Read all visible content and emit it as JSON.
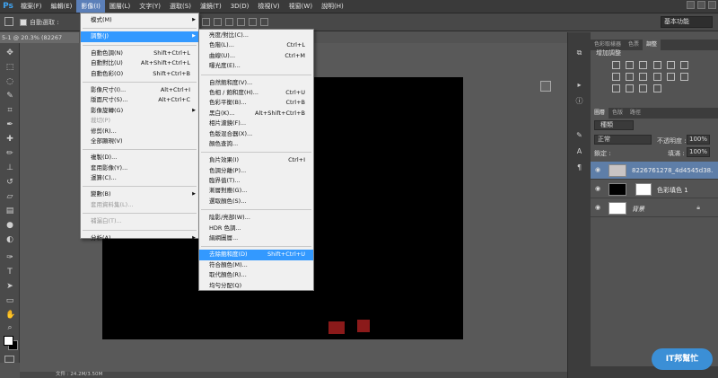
{
  "menubar": {
    "logo": "Ps",
    "items": [
      "檔案(F)",
      "編輯(E)",
      "影像(I)",
      "圖層(L)",
      "文字(Y)",
      "選取(S)",
      "濾鏡(T)",
      "3D(D)",
      "檢視(V)",
      "視窗(W)",
      "說明(H)"
    ]
  },
  "options": {
    "autoselect_label": "自動選取 :",
    "workspace": "基本功能"
  },
  "document": {
    "tab_label": "5-1 @ 20.3% (82267",
    "status_text": "文件 : 24.2M/3.50M"
  },
  "image_menu": {
    "items": [
      {
        "label": "模式(M)",
        "shortcut": "",
        "submenu": true,
        "disabled": false
      },
      {
        "sep": true
      },
      {
        "label": "調整(J)",
        "shortcut": "",
        "submenu": true,
        "disabled": false,
        "highlight": true
      },
      {
        "sep": true
      },
      {
        "label": "自動色調(N)",
        "shortcut": "Shift+Ctrl+L",
        "submenu": false,
        "disabled": false
      },
      {
        "label": "自動對比(U)",
        "shortcut": "Alt+Shift+Ctrl+L",
        "submenu": false,
        "disabled": false
      },
      {
        "label": "自動色彩(O)",
        "shortcut": "Shift+Ctrl+B",
        "submenu": false,
        "disabled": false
      },
      {
        "sep": true
      },
      {
        "label": "影像尺寸(I)...",
        "shortcut": "Alt+Ctrl+I",
        "submenu": false,
        "disabled": false
      },
      {
        "label": "版面尺寸(S)...",
        "shortcut": "Alt+Ctrl+C",
        "submenu": false,
        "disabled": false
      },
      {
        "label": "影像旋轉(G)",
        "shortcut": "",
        "submenu": true,
        "disabled": false
      },
      {
        "label": "裁切(P)",
        "shortcut": "",
        "submenu": false,
        "disabled": true
      },
      {
        "label": "修剪(R)...",
        "shortcut": "",
        "submenu": false,
        "disabled": false
      },
      {
        "label": "全部顯現(V)",
        "shortcut": "",
        "submenu": false,
        "disabled": false
      },
      {
        "sep": true
      },
      {
        "label": "複製(D)...",
        "shortcut": "",
        "submenu": false,
        "disabled": false
      },
      {
        "label": "套用影像(Y)...",
        "shortcut": "",
        "submenu": false,
        "disabled": false
      },
      {
        "label": "運算(C)...",
        "shortcut": "",
        "submenu": false,
        "disabled": false
      },
      {
        "sep": true
      },
      {
        "label": "變數(B)",
        "shortcut": "",
        "submenu": true,
        "disabled": false
      },
      {
        "label": "套用資料集(L)...",
        "shortcut": "",
        "submenu": false,
        "disabled": true
      },
      {
        "sep": true
      },
      {
        "label": "補漏白(T)...",
        "shortcut": "",
        "submenu": false,
        "disabled": true
      },
      {
        "sep": true
      },
      {
        "label": "分析(A)",
        "shortcut": "",
        "submenu": true,
        "disabled": false
      }
    ]
  },
  "adjust_menu": {
    "items": [
      {
        "label": "亮度/對比(C)...",
        "shortcut": ""
      },
      {
        "label": "色階(L)...",
        "shortcut": "Ctrl+L"
      },
      {
        "label": "曲線(U)...",
        "shortcut": "Ctrl+M"
      },
      {
        "label": "曝光度(E)...",
        "shortcut": ""
      },
      {
        "sep": true
      },
      {
        "label": "自然飽和度(V)...",
        "shortcut": ""
      },
      {
        "label": "色相 / 飽和度(H)...",
        "shortcut": "Ctrl+U"
      },
      {
        "label": "色彩平衡(B)...",
        "shortcut": "Ctrl+B"
      },
      {
        "label": "黑白(K)...",
        "shortcut": "Alt+Shift+Ctrl+B"
      },
      {
        "label": "相片濾鏡(F)...",
        "shortcut": ""
      },
      {
        "label": "色版混合器(X)...",
        "shortcut": ""
      },
      {
        "label": "顏色查詢...",
        "shortcut": ""
      },
      {
        "sep": true
      },
      {
        "label": "負片效果(I)",
        "shortcut": "Ctrl+I"
      },
      {
        "label": "色調分離(P)...",
        "shortcut": ""
      },
      {
        "label": "臨界值(T)...",
        "shortcut": ""
      },
      {
        "label": "漸層對應(G)...",
        "shortcut": ""
      },
      {
        "label": "選取顏色(S)...",
        "shortcut": ""
      },
      {
        "sep": true
      },
      {
        "label": "陰影/亮部(W)...",
        "shortcut": ""
      },
      {
        "label": "HDR 色調...",
        "shortcut": ""
      },
      {
        "label": "絹網圖層...",
        "shortcut": ""
      },
      {
        "sep": true
      },
      {
        "label": "去除飽和度(D)",
        "shortcut": "Shift+Ctrl+U",
        "highlight": true
      },
      {
        "label": "符合顏色(M)...",
        "shortcut": ""
      },
      {
        "label": "取代顏色(R)...",
        "shortcut": ""
      },
      {
        "label": "均勻分配(Q)",
        "shortcut": ""
      }
    ]
  },
  "panels": {
    "top_tabs": [
      "色彩取樣器",
      "色票",
      "樣式",
      "調整"
    ],
    "adjust_title": "增加調整",
    "layer_tabs": [
      "圖層",
      "色版",
      "路徑"
    ],
    "kind_filter": "種類",
    "blend_mode": "正常",
    "opacity_label": "不透明度 :",
    "opacity_value": "100%",
    "lock_label": "鎖定 :",
    "fill_label": "填滿 :",
    "fill_value": "100%",
    "layers": [
      {
        "name": "8226761278_4d4545d38...",
        "selected": true
      },
      {
        "name": "色彩填色 1",
        "selected": false
      },
      {
        "name": "背景",
        "selected": false
      }
    ]
  },
  "watermark": {
    "text": "IT邦幫忙"
  },
  "colors": {
    "accent": "#3399ff",
    "selected_layer": "#5e7ea8",
    "menubar_active": "#5b7fb8"
  }
}
